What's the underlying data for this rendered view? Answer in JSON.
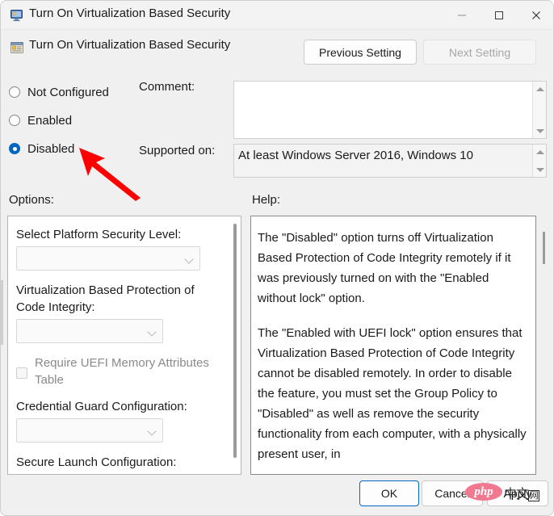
{
  "window": {
    "title": "Turn On Virtualization Based Security",
    "title_icon": "computer-monitor-icon",
    "minimize_label": "─",
    "maximize_label": "□",
    "close_label": "✕"
  },
  "header": {
    "icon": "group-policy-setting-icon",
    "title": "Turn On Virtualization Based Security",
    "previous_setting_label": "Previous Setting",
    "next_setting_label": "Next Setting",
    "next_setting_disabled": true
  },
  "state": {
    "options": [
      {
        "label": "Not Configured",
        "selected": false
      },
      {
        "label": "Enabled",
        "selected": false
      },
      {
        "label": "Disabled",
        "selected": true
      }
    ]
  },
  "comment": {
    "label": "Comment:",
    "value": "",
    "placeholder": ""
  },
  "supported_on": {
    "label": "Supported on:",
    "value": "At least Windows Server 2016, Windows 10"
  },
  "options_panel": {
    "label": "Options:",
    "fields": [
      {
        "type": "label",
        "text": "Select Platform Security Level:",
        "dimmed": false
      },
      {
        "type": "combo",
        "value": "",
        "width": "wide"
      },
      {
        "type": "label",
        "text": "Virtualization Based Protection of Code Integrity:",
        "dimmed": false
      },
      {
        "type": "combo",
        "value": "",
        "width": "narrow"
      },
      {
        "type": "checkbox",
        "text": "Require UEFI Memory Attributes Table",
        "checked": false,
        "dimmed": true
      },
      {
        "type": "label",
        "text": "Credential Guard Configuration:",
        "dimmed": false
      },
      {
        "type": "combo",
        "value": "",
        "width": "narrow"
      },
      {
        "type": "label",
        "text": "Secure Launch Configuration:",
        "dimmed": false
      }
    ]
  },
  "help_panel": {
    "label": "Help:",
    "paragraphs": [
      "The \"Disabled\" option turns off Virtualization Based Protection of Code Integrity remotely if it was previously turned on with the \"Enabled without lock\" option.",
      "The \"Enabled with UEFI lock\" option ensures that Virtualization Based Protection of Code Integrity cannot be disabled remotely. In order to disable the feature, you must set the Group Policy to \"Disabled\" as well as remove the security functionality from each computer, with a physically present user, in"
    ]
  },
  "footer": {
    "ok_label": "OK",
    "cancel_label": "Cancel",
    "apply_label": "Apply"
  },
  "annotation": {
    "arrow_color": "#ff0000",
    "points_to": "Disabled"
  },
  "watermark": {
    "brand": "php",
    "suffix": "中文",
    "boxed_suffix": "网"
  }
}
